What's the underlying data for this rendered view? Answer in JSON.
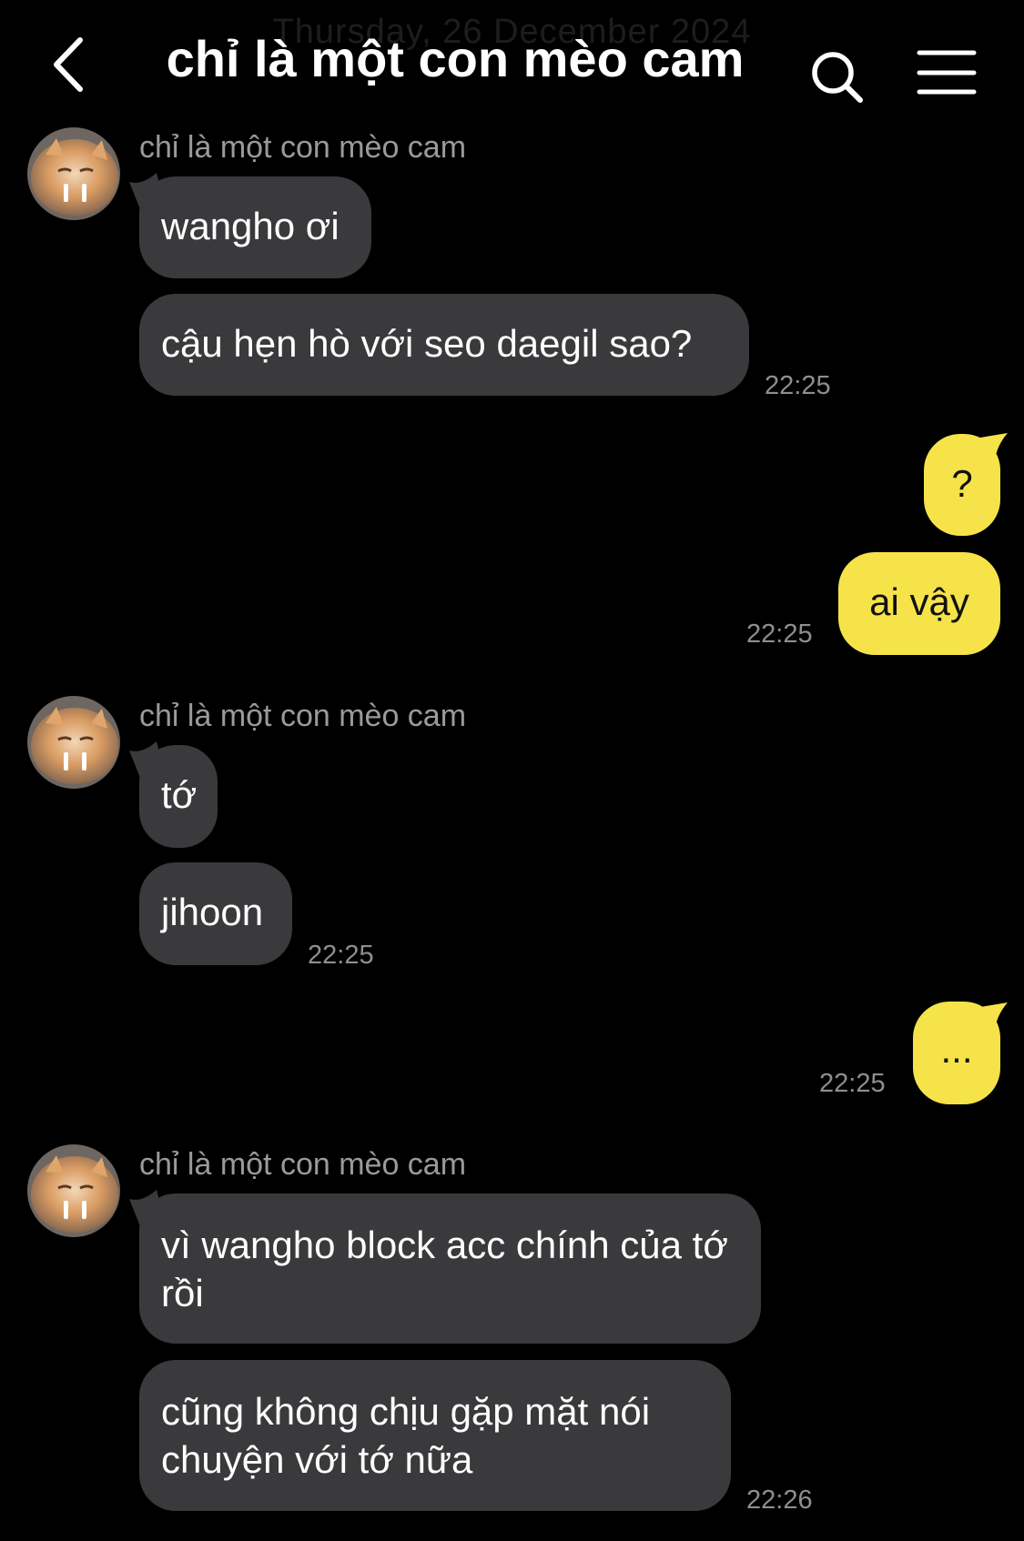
{
  "header": {
    "date_label": "Thursday, 26 December 2024",
    "title": "chỉ là một con mèo cam"
  },
  "icons": {
    "back": "chevron-left-icon",
    "search": "search-icon",
    "menu": "hamburger-menu-icon"
  },
  "colors": {
    "background": "#000000",
    "incoming_bubble": "#3a3a3c",
    "outgoing_bubble": "#f6e34a"
  },
  "groups": [
    {
      "sender": "chỉ là một con mèo cam",
      "messages": [
        "wangho ơi",
        "cậu hẹn hò với seo daegil sao?"
      ],
      "time": "22:25"
    },
    {
      "messages": [
        "?",
        "ai vậy"
      ],
      "time": "22:25"
    },
    {
      "sender": "chỉ là một con mèo cam",
      "messages": [
        "tớ",
        "jihoon"
      ],
      "time": "22:25"
    },
    {
      "messages": [
        "..."
      ],
      "time": "22:25"
    },
    {
      "sender": "chỉ là một con mèo cam",
      "messages": [
        "vì wangho block acc chính của tớ rồi",
        "cũng không chịu gặp mặt nói chuyện với tớ nữa"
      ],
      "time": "22:26"
    }
  ]
}
